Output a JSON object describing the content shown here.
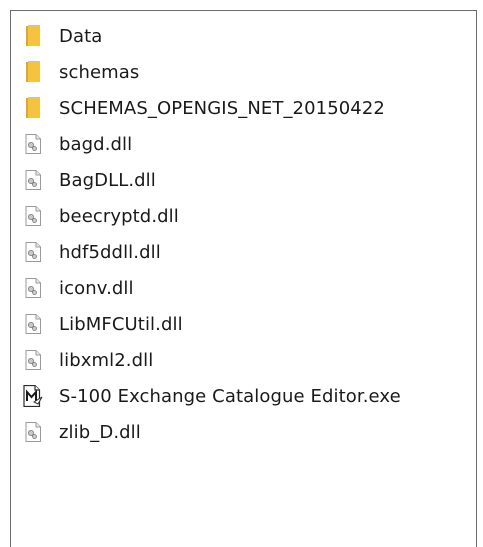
{
  "files": [
    {
      "name": "Data",
      "type": "folder"
    },
    {
      "name": "schemas",
      "type": "folder"
    },
    {
      "name": "SCHEMAS_OPENGIS_NET_20150422",
      "type": "folder"
    },
    {
      "name": "bagd.dll",
      "type": "dll"
    },
    {
      "name": "BagDLL.dll",
      "type": "dll"
    },
    {
      "name": "beecryptd.dll",
      "type": "dll"
    },
    {
      "name": "hdf5ddll.dll",
      "type": "dll"
    },
    {
      "name": "iconv.dll",
      "type": "dll"
    },
    {
      "name": "LibMFCUtil.dll",
      "type": "dll"
    },
    {
      "name": "libxml2.dll",
      "type": "dll"
    },
    {
      "name": "S-100 Exchange Catalogue Editor.exe",
      "type": "exe"
    },
    {
      "name": "zlib_D.dll",
      "type": "dll"
    }
  ],
  "icons": {
    "folder": "folder-icon",
    "dll": "dll-file-icon",
    "exe": "application-icon"
  },
  "colors": {
    "folder": "#f5c342",
    "folder_dark": "#e0a82a",
    "text": "#1a1a1a"
  }
}
